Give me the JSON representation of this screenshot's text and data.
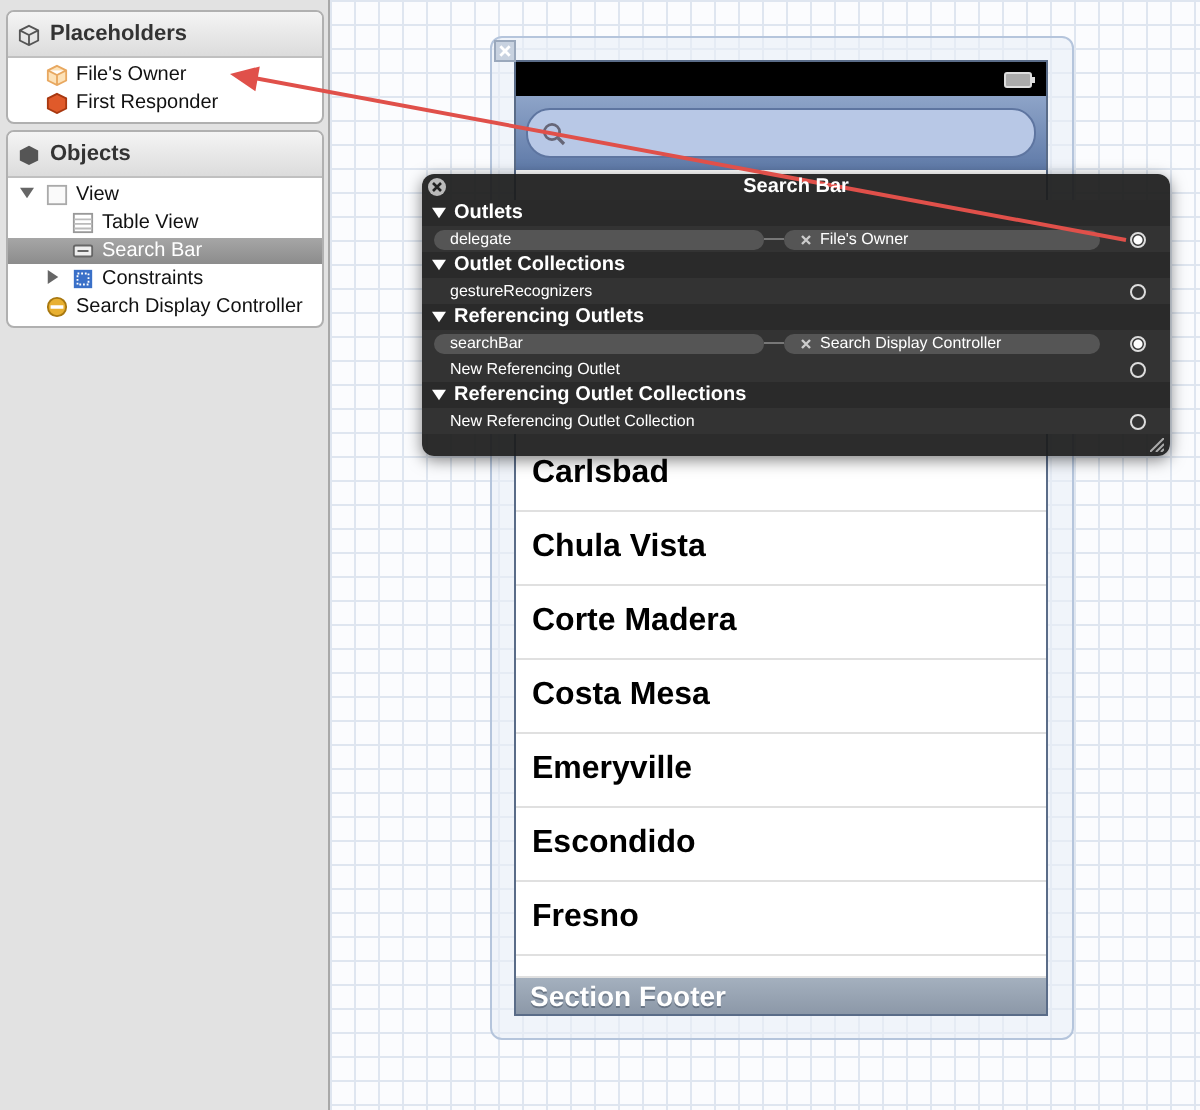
{
  "sidebar": {
    "sections": [
      {
        "title": "Placeholders",
        "kind": "placeholders",
        "items": [
          {
            "label": "File's Owner",
            "kind": "owner",
            "selected": false
          },
          {
            "label": "First Responder",
            "kind": "responder",
            "selected": false
          }
        ]
      },
      {
        "title": "Objects",
        "kind": "objects",
        "items": [
          {
            "label": "View",
            "kind": "view",
            "selected": false,
            "expanded": true,
            "children": [
              {
                "label": "Table View",
                "kind": "table",
                "selected": false
              },
              {
                "label": "Search Bar",
                "kind": "searchbar",
                "selected": true
              },
              {
                "label": "Constraints",
                "kind": "constraints",
                "selected": false,
                "expanded": false
              }
            ]
          },
          {
            "label": "Search Display Controller",
            "kind": "controller",
            "selected": false
          }
        ]
      }
    ]
  },
  "table": {
    "rows": [
      "Carlsbad",
      "Chula Vista",
      "Corte Madera",
      "Costa Mesa",
      "Emeryville",
      "Escondido",
      "Fresno"
    ],
    "footer": "Section Footer"
  },
  "popup": {
    "title": "Search Bar",
    "sections": [
      {
        "title": "Outlets",
        "expanded": true,
        "rows": [
          {
            "name": "delegate",
            "target": "File's Owner",
            "connected": true
          }
        ]
      },
      {
        "title": "Outlet Collections",
        "expanded": true,
        "rows": [
          {
            "name": "gestureRecognizers",
            "connected": false
          }
        ]
      },
      {
        "title": "Referencing Outlets",
        "expanded": true,
        "rows": [
          {
            "name": "searchBar",
            "target": "Search Display Controller",
            "connected": true
          },
          {
            "name": "New Referencing Outlet",
            "connected": false
          }
        ]
      },
      {
        "title": "Referencing Outlet Collections",
        "expanded": true,
        "rows": [
          {
            "name": "New Referencing Outlet Collection",
            "connected": false
          }
        ]
      }
    ]
  }
}
